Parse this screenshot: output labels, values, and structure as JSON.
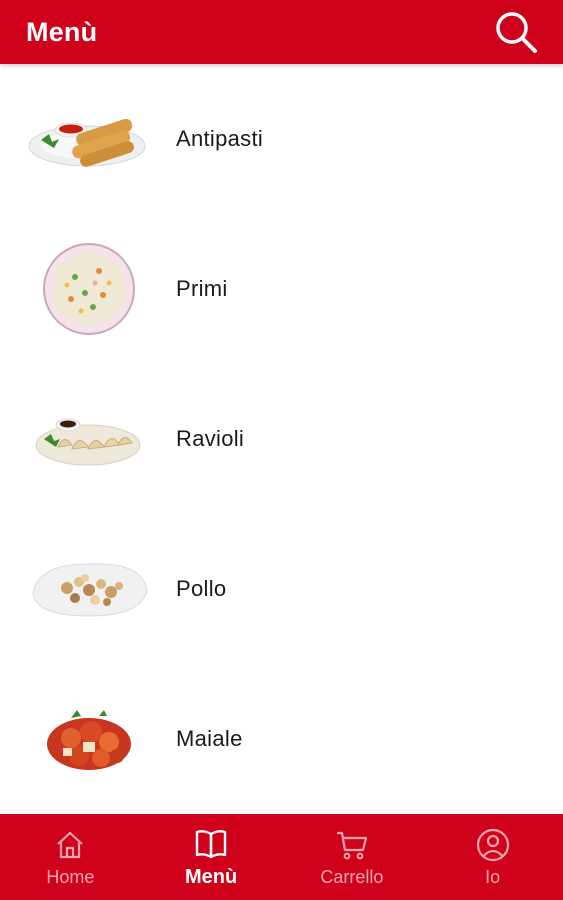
{
  "header": {
    "title": "Menù",
    "color": "#d0021b",
    "search_icon": "search-icon"
  },
  "menu": {
    "items": [
      {
        "label": "Antipasti",
        "image": "spring-rolls-plate"
      },
      {
        "label": "Primi",
        "image": "fried-rice-plate"
      },
      {
        "label": "Ravioli",
        "image": "dumplings-plate"
      },
      {
        "label": "Pollo",
        "image": "chicken-plate"
      },
      {
        "label": "Maiale",
        "image": "sweet-sour-pork"
      }
    ]
  },
  "bottom_nav": {
    "active": "Menù",
    "items": [
      {
        "label": "Home",
        "icon": "home-icon"
      },
      {
        "label": "Menù",
        "icon": "book-icon"
      },
      {
        "label": "Carrello",
        "icon": "cart-icon"
      },
      {
        "label": "Io",
        "icon": "user-icon"
      }
    ]
  }
}
